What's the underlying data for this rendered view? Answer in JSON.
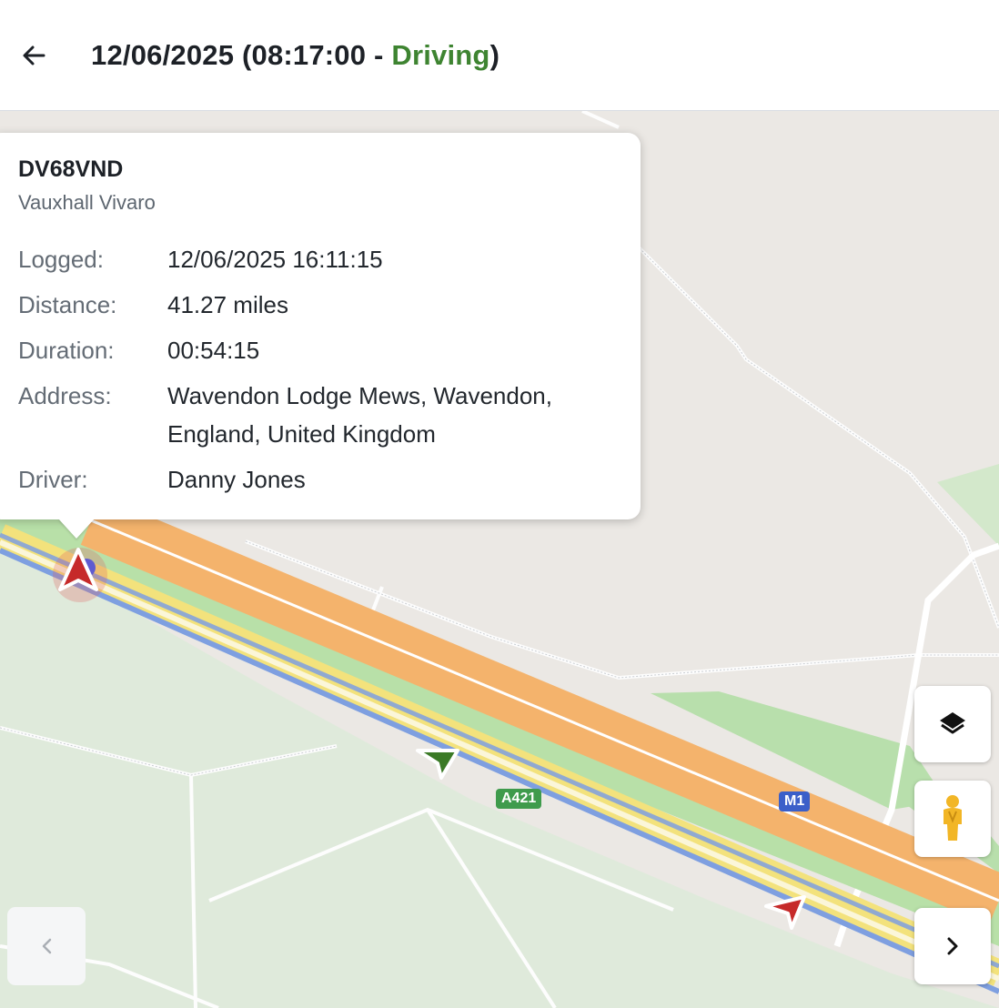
{
  "header": {
    "date": "12/06/2025",
    "open": " (",
    "time": "08:17:00",
    "sep": " - ",
    "status": "Driving",
    "close": ")",
    "status_color": "#3e8431"
  },
  "popup": {
    "plate": "DV68VND",
    "model": "Vauxhall Vivaro",
    "rows": [
      {
        "label": "Logged:",
        "value": "12/06/2025 16:11:15"
      },
      {
        "label": "Distance:",
        "value": "41.27 miles"
      },
      {
        "label": "Duration:",
        "value": "00:54:15"
      },
      {
        "label": "Address:",
        "value": "Wavendon Lodge Mews, Wavendon, England, United Kingdom"
      },
      {
        "label": "Driver:",
        "value": "Danny Jones"
      }
    ]
  },
  "map": {
    "road_labels": {
      "a421": "A421",
      "m1": "M1"
    },
    "road_colors": {
      "motorway": "#f6b26b",
      "a_road": "#75b453",
      "route": "#7e9fe0"
    },
    "markers": {
      "red": "#c62a2a",
      "green": "#3b7a26"
    }
  },
  "controls": {
    "layers": "layers-icon",
    "street_view": "pegman-icon",
    "prev": "chevron-left-icon",
    "next": "chevron-right-icon"
  }
}
